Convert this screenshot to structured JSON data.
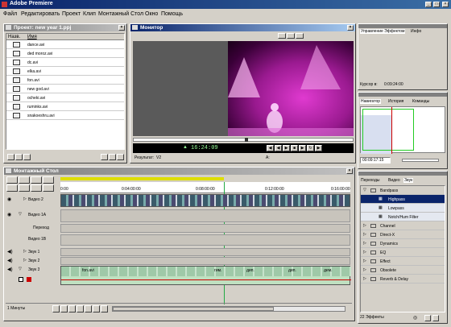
{
  "app": {
    "title": "Adobe Premiere"
  },
  "menu": [
    "Файл",
    "Редактировать",
    "Проект",
    "Клип",
    "Монтажный Стол",
    "Окно",
    "Помощь"
  ],
  "project": {
    "title": "Проект: new year 1.ppj",
    "col_type": "Назв.",
    "col_name": "Имя",
    "files": [
      "dance.avi",
      "ded moroz.avi",
      "dc.avi",
      "elka.avi",
      "fon.avi",
      "new god.avi",
      "ocheki.avi",
      "ruminks.avi",
      "snakoeshru.avi"
    ]
  },
  "monitor": {
    "title": "Монитор",
    "timecode": "16:24:09",
    "target_label": "Результат:",
    "target_value": "V2",
    "audio_label": "A:"
  },
  "effects_panel": {
    "tabs": [
      "Управление Эффектом",
      "Инфо"
    ],
    "cursor_label": "Курсор в:",
    "cursor_value": "0:09:24:00"
  },
  "navigator": {
    "tabs": [
      "Навигатор",
      "История",
      "Команды"
    ],
    "timecode": "00:09:17:15"
  },
  "transitions": {
    "tabs": [
      "Переходы",
      "Видео",
      "Звук"
    ],
    "items": [
      "Bandpass",
      "Highpass",
      "Lowpass",
      "Notch/Hum Filter",
      "Channel",
      "Direct-X",
      "Dynamics",
      "EQ",
      "Effect",
      "Obsolete",
      "Reverb & Delay"
    ],
    "footer": "22 Эффекты"
  },
  "timeline": {
    "title": "Монтажный Стол",
    "ruler": [
      "0:00",
      "0:04:00:00",
      "0:08:00:00",
      "0:12:00:00",
      "0:16:00:00"
    ],
    "tracks": [
      "Видео 2",
      "Видео 1А",
      "Переход",
      "Видео 1В",
      "Звук 1",
      "Звук 2",
      "Звук 3"
    ],
    "audio_clips": [
      "fon.avi",
      "гим.",
      "дип.",
      "дип.",
      "дем."
    ],
    "zoom": "1 Минуты"
  }
}
